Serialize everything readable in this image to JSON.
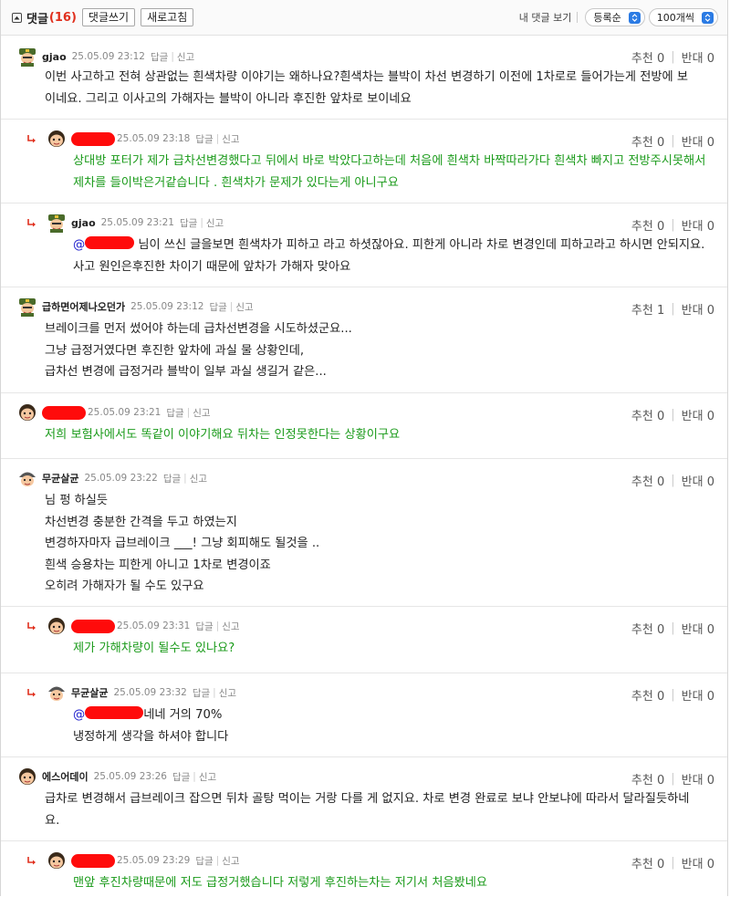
{
  "header": {
    "title": "댓글",
    "count": "(16)",
    "write_btn": "댓글쓰기",
    "refresh_btn": "새로고침",
    "my_comments": "내 댓글 보기",
    "sort_select": "등록순",
    "per_page_select": "100개씩"
  },
  "labels": {
    "reply": "답글",
    "report": "신고",
    "up": "추천",
    "down": "반대"
  },
  "comments": [
    {
      "nick": "gjao",
      "date": "25.05.09 23:12",
      "up": "0",
      "down": "0",
      "lines": [
        "이번 사고하고 전혀 상관없는 흰색차량 이야기는 왜하나요?흰색차는 블박이 차선 변경하기 이전에 1차로로 들어가는게 전방에 보",
        "이네요. 그리고 이사고의 가해자는 블박이 아니라 후진한 앞차로 보이네요"
      ]
    },
    {
      "nick": "",
      "date": "25.05.09 23:18",
      "up": "0",
      "down": "0",
      "lines": [
        "상대방 포터가 제가 급차선변경했다고 뒤에서 바로 박았다고하는데 처음에 흰색차 바짝따라가다 흰색차 빠지고 전방주시못해서",
        "제차를 들이박은거같습니다 . 흰색차가 문제가 있다는게 아니구요"
      ]
    },
    {
      "nick": "gjao",
      "date": "25.05.09 23:21",
      "up": "0",
      "down": "0",
      "mention": "@",
      "lines": [
        " 님이 쓰신 글을보면 흰색차가 피하고 라고 하셧잖아요. 피한게 아니라 차로 변경인데 피하고라고 하시면 안되지요.",
        "사고 원인은후진한 차이기 때문에 앞차가 가해자 맞아요"
      ]
    },
    {
      "nick": "급하면어제나오던가",
      "date": "25.05.09 23:12",
      "up": "1",
      "down": "0",
      "lines": [
        "브레이크를 먼저 썼어야 하는데 급차선변경을 시도하셨군요...",
        "그냥 급정거였다면 후진한 앞차에 과실 물 상황인데,",
        "급차선 변경에 급정거라 블박이 일부 과실 생길거 같은..."
      ]
    },
    {
      "nick": "",
      "date": "25.05.09 23:21",
      "up": "0",
      "down": "0",
      "lines": [
        "저희 보험사에서도 똑같이 이야기해요 뒤차는 인정못한다는 상황이구요"
      ]
    },
    {
      "nick": "무균살균",
      "date": "25.05.09 23:22",
      "up": "0",
      "down": "0",
      "lines": [
        "님 펑 하실듯",
        "차선변경 충분한 간격을 두고 하였는지",
        "변경하자마자 급브레이크 ___! 그냥 회피해도 될것을 ..",
        "흰색 승용차는 피한게 아니고 1차로 변경이죠",
        "오히려 가해자가 될 수도 있구요"
      ]
    },
    {
      "nick": "",
      "date": "25.05.09 23:31",
      "up": "0",
      "down": "0",
      "lines": [
        "제가 가해차량이 될수도 있나요?"
      ]
    },
    {
      "nick": "무균살균",
      "date": "25.05.09 23:32",
      "up": "0",
      "down": "0",
      "mention": "@",
      "lines": [
        "네네 거의 70%",
        "냉정하게 생각을 하셔야 합니다"
      ]
    },
    {
      "nick": "에스어데이",
      "date": "25.05.09 23:26",
      "up": "0",
      "down": "0",
      "lines": [
        "급차로 변경해서 급브레이크 잡으면 뒤차 골탕 먹이는 거랑 다를 게 없지요. 차로 변경 완료로 보냐 안보냐에 따라서 달라질듯하네",
        "요."
      ]
    },
    {
      "nick": "",
      "date": "25.05.09 23:29",
      "up": "0",
      "down": "0",
      "lines": [
        "맨앞 후진차량때문에 저도 급정거했습니다 저렇게 후진하는차는 저기서 처음봤네요"
      ]
    }
  ]
}
